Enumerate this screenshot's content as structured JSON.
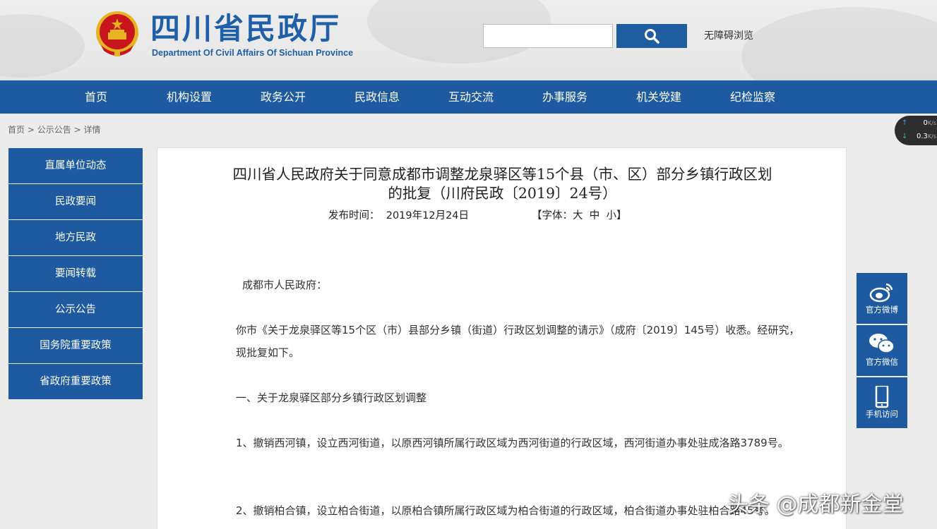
{
  "header": {
    "site_title": "四川省民政厅",
    "site_subtitle": "Department Of Civil Affairs Of Sichuan Province",
    "search_placeholder": "",
    "accessibility": "无障碍浏览"
  },
  "nav": {
    "items": [
      {
        "label": "首页"
      },
      {
        "label": "机构设置"
      },
      {
        "label": "政务公开"
      },
      {
        "label": "民政信息"
      },
      {
        "label": "互动交流"
      },
      {
        "label": "办事服务"
      },
      {
        "label": "机关党建"
      },
      {
        "label": "纪检监察"
      }
    ]
  },
  "breadcrumb": {
    "home": "首页",
    "sep": ">",
    "section": "公示公告",
    "current": "详情"
  },
  "sidebar": {
    "items": [
      {
        "label": "直属单位动态"
      },
      {
        "label": "民政要闻"
      },
      {
        "label": "地方民政"
      },
      {
        "label": "要闻转载"
      },
      {
        "label": "公示公告"
      },
      {
        "label": "国务院重要政策"
      },
      {
        "label": "省政府重要政策"
      }
    ]
  },
  "article": {
    "title_line1": "四川省人民政府关于同意成都市调整龙泉驿区等15个县（市、区）部分乡镇行政区划",
    "title_line2": "的批复（川府民政〔2019〕24号）",
    "publish_label": "发布时间：",
    "publish_date": "2019年12月24日",
    "font_label": "【字体：",
    "font_large": "大",
    "font_medium": "中",
    "font_small": "小",
    "font_close": "】",
    "salutation": "成都市人民政府：",
    "para1": "你市《关于龙泉驿区等15个区（市）县部分乡镇（街道）行政区划调整的请示》（成府〔2019〕145号）收悉。经研究，现批复如下。",
    "heading1": "一、关于龙泉驿区部分乡镇行政区划调整",
    "item1": "1、撤销西河镇，设立西河街道，以原西河镇所属行政区域为西河街道的行政区域，西河街道办事处驻成洛路3789号。",
    "item2": "2、撤销柏合镇，设立柏合街道，以原柏合镇所属行政区域为柏合街道的行政区域，柏合街道办事处驻柏合路45号。"
  },
  "speed": {
    "up_value": "0",
    "down_value": "0.3",
    "unit": "K/s"
  },
  "float": {
    "weibo": "官方微博",
    "wechat": "官方微信",
    "mobile": "手机访问"
  },
  "watermark": "头条 @成都新金堂",
  "colors": {
    "brand_blue": "#1e5aa0",
    "title_blue": "#1f5ea8",
    "emblem_red": "#c8161d",
    "emblem_gold": "#e6b422"
  }
}
